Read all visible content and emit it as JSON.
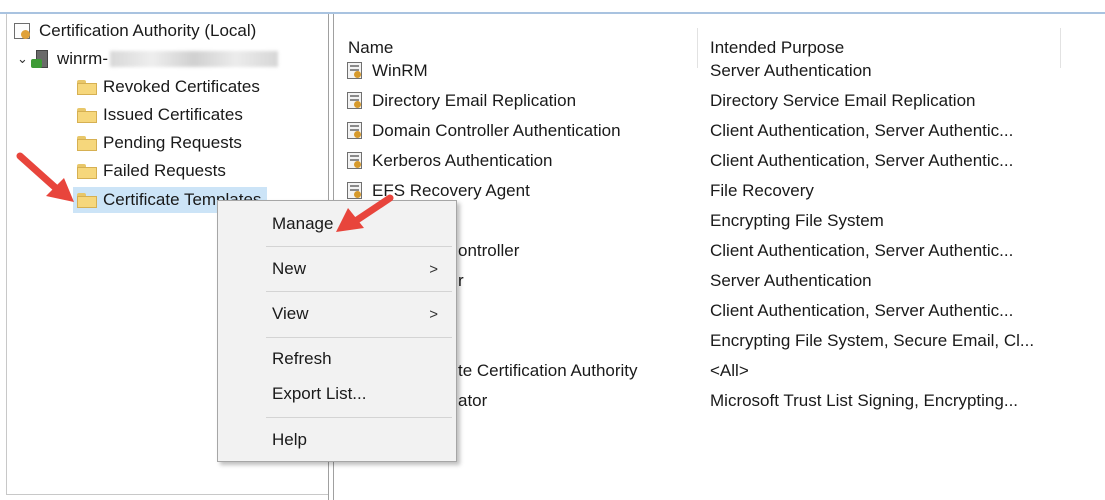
{
  "tree": {
    "root_label": "Certification Authority (Local)",
    "server_label": "winrm-",
    "items": [
      {
        "label": "Revoked Certificates"
      },
      {
        "label": "Issued Certificates"
      },
      {
        "label": "Pending Requests"
      },
      {
        "label": "Failed Requests"
      },
      {
        "label": "Certificate Templates"
      }
    ]
  },
  "list": {
    "col_name": "Name",
    "col_purpose": "Intended Purpose",
    "rows": [
      {
        "name": "WinRM",
        "purpose": "Server Authentication"
      },
      {
        "name": "Directory Email Replication",
        "purpose": "Directory Service Email Replication"
      },
      {
        "name": "Domain Controller Authentication",
        "purpose": "Client Authentication, Server Authentic..."
      },
      {
        "name": "Kerberos Authentication",
        "purpose": "Client Authentication, Server Authentic..."
      },
      {
        "name": "EFS Recovery Agent",
        "purpose": "File Recovery"
      },
      {
        "name": "",
        "purpose": "Encrypting File System"
      },
      {
        "name": "ontroller",
        "purpose": "Client Authentication, Server Authentic..."
      },
      {
        "name": "r",
        "purpose": "Server Authentication"
      },
      {
        "name": "",
        "purpose": "Client Authentication, Server Authentic..."
      },
      {
        "name": "",
        "purpose": "Encrypting File System, Secure Email, Cl..."
      },
      {
        "name": "te Certification Authority",
        "purpose": "<All>"
      },
      {
        "name": "ator",
        "purpose": "Microsoft Trust List Signing, Encrypting..."
      }
    ]
  },
  "context_menu": {
    "manage": "Manage",
    "new": "New",
    "view": "View",
    "refresh": "Refresh",
    "export": "Export List...",
    "help": "Help",
    "submenu_glyph": ">"
  },
  "colors": {
    "selection": "#cce4f7",
    "annotation_arrow": "#e8453c"
  }
}
